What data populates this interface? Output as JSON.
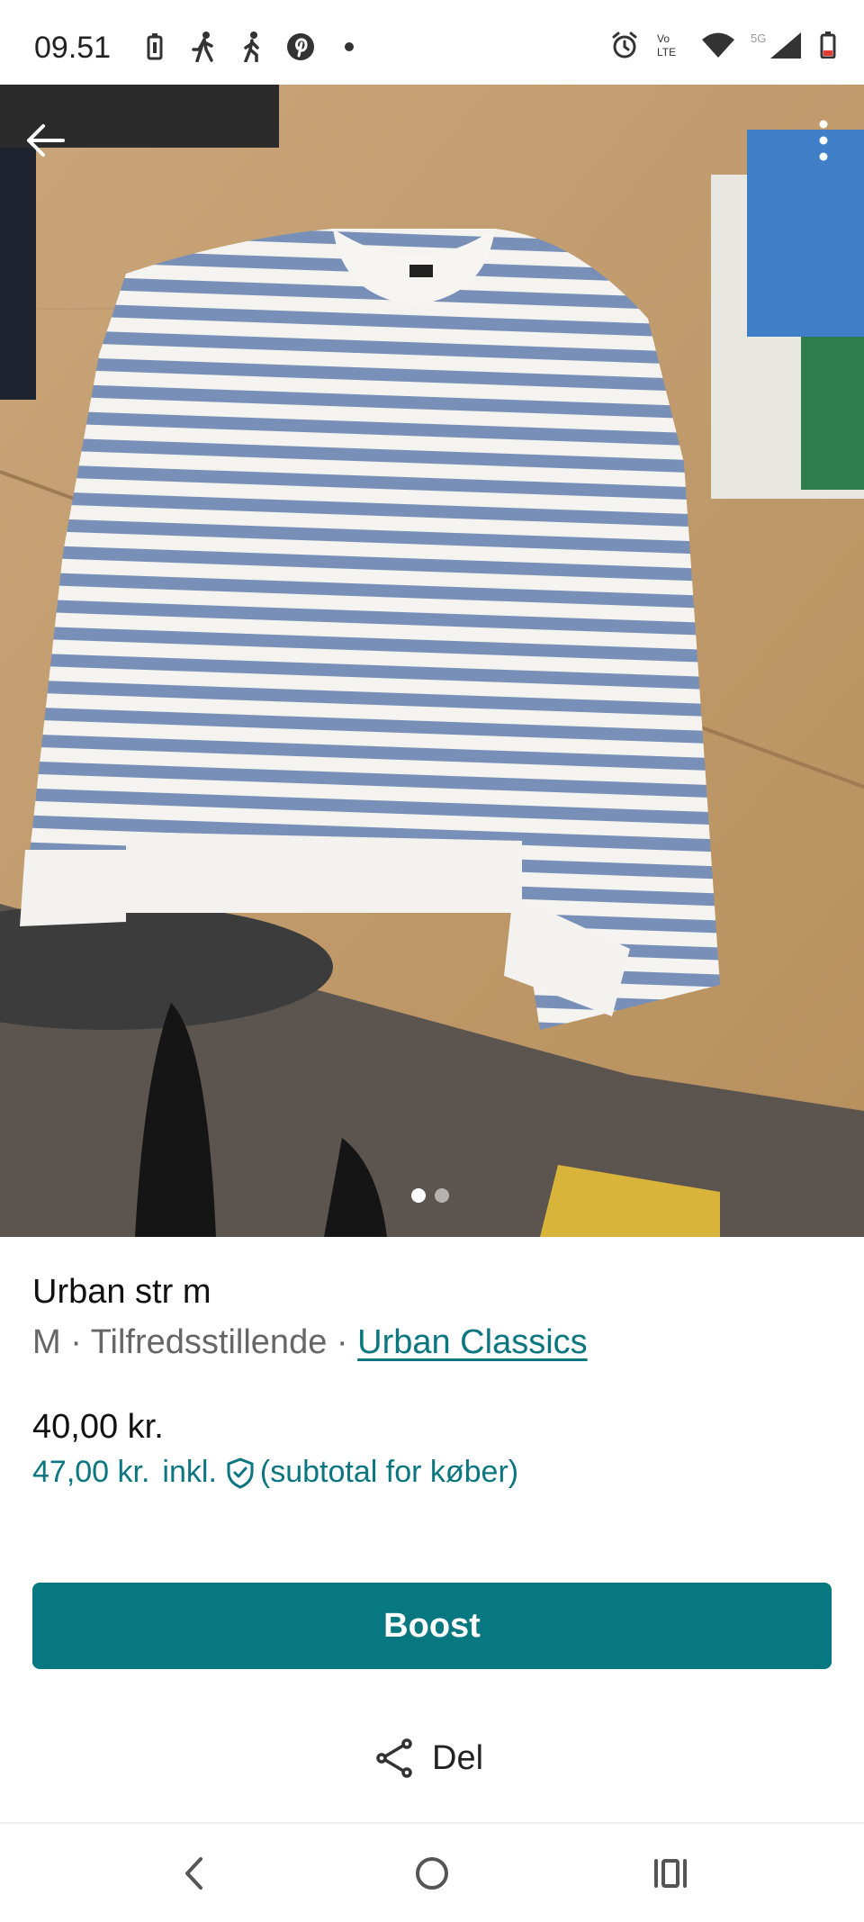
{
  "status_bar": {
    "time": "09.51",
    "left_icons": [
      "battery-saver-icon",
      "walking-icon",
      "walking-icon",
      "pinterest-icon",
      "dot-icon"
    ],
    "right_icons": [
      "alarm-icon",
      "volte-icon",
      "wifi-icon",
      "5g-signal-icon",
      "battery-icon"
    ]
  },
  "gallery": {
    "image_count": 2,
    "active_index": 0
  },
  "listing": {
    "title": "Urban str m",
    "size": "M",
    "separator": " · ",
    "condition": "Tilfredsstillende",
    "brand": "Urban Classics",
    "price": "40,00 kr.",
    "price_incl": "47,00 kr.",
    "incl_label": "inkl.",
    "subtotal_note": "(subtotal for køber)"
  },
  "actions": {
    "boost_label": "Boost",
    "share_label": "Del"
  },
  "colors": {
    "accent": "#077780",
    "link": "#0b7680"
  }
}
